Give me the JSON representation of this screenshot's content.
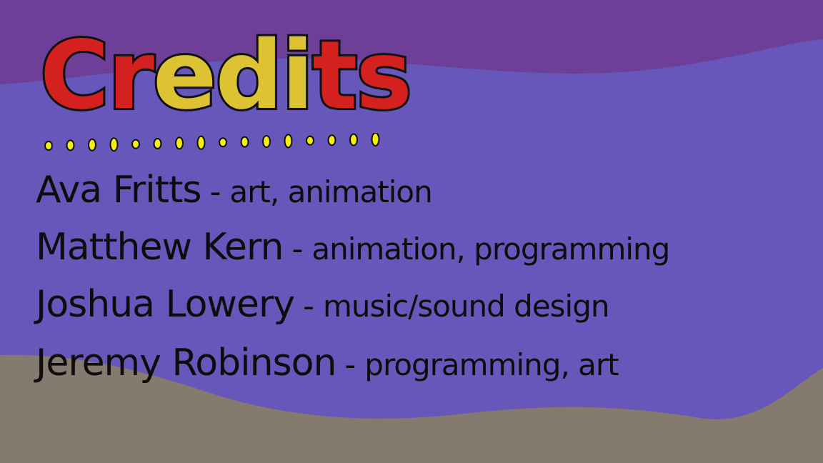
{
  "title": {
    "letters": [
      "C",
      "r",
      "e",
      "d",
      "i",
      "t",
      "s"
    ],
    "letter_colors": [
      "#d42120",
      "#d42120",
      "#ddc334",
      "#ddc334",
      "#ddc334",
      "#d42120",
      "#d42120"
    ],
    "outline_color": "#111111"
  },
  "dots_color": "#f4ee12",
  "colors": {
    "sky": "#6d3f98",
    "band": "#6757bb",
    "ground": "#857a6e",
    "text": "#0d0d0d"
  },
  "credits": [
    {
      "name": "Ava Fritts",
      "separator": "-",
      "role": "art, animation"
    },
    {
      "name": "Matthew Kern",
      "separator": "-",
      "role": "animation, programming"
    },
    {
      "name": "Joshua Lowery",
      "separator": "-",
      "role": "music/sound design"
    },
    {
      "name": "Jeremy Robinson",
      "separator": "-",
      "role": "programming, art"
    }
  ]
}
